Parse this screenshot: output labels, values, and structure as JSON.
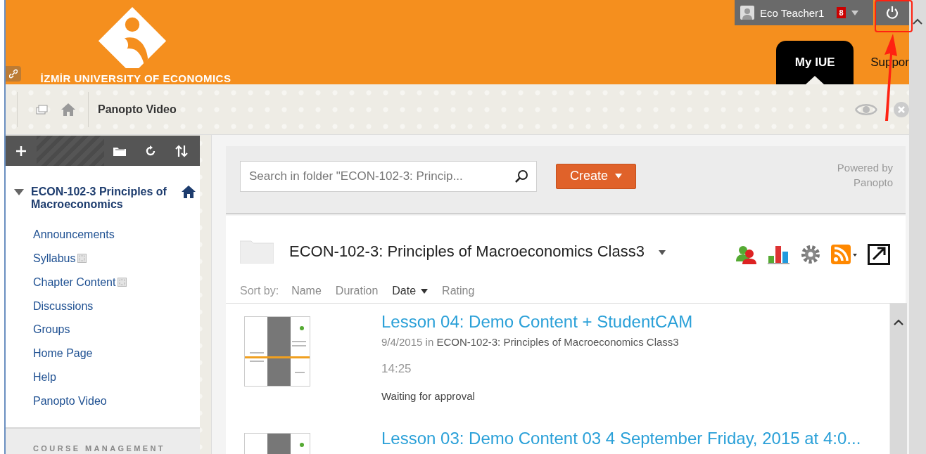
{
  "header": {
    "logo_text": "İZMİR UNIVERSITY OF ECONOMICS",
    "user_name": "Eco Teacher1",
    "notification_count": "8",
    "tabs": [
      {
        "label": "My IUE",
        "selected": true
      },
      {
        "label": "Suppor",
        "selected": false
      }
    ]
  },
  "breadcrumb": {
    "title": "Panopto Video"
  },
  "sidebar": {
    "course": {
      "title": "ECON-102-3 Principles of Macroeconomics",
      "expanded": true
    },
    "items": [
      {
        "label": "Announcements",
        "unavailable": false
      },
      {
        "label": "Syllabus",
        "unavailable": true
      },
      {
        "label": "Chapter Content",
        "unavailable": true
      },
      {
        "label": "Discussions",
        "unavailable": false
      },
      {
        "label": "Groups",
        "unavailable": false
      },
      {
        "label": "Home Page",
        "unavailable": false
      },
      {
        "label": "Help",
        "unavailable": false
      },
      {
        "label": "Panopto Video",
        "unavailable": false
      }
    ],
    "section_heading": "COURSE MANAGEMENT"
  },
  "panopto": {
    "search": {
      "placeholder": "Search in folder \"ECON-102-3: Princip..."
    },
    "create_button": "Create",
    "powered_by": "Powered by Panopto",
    "folder_title": "ECON-102-3: Principles of Macroeconomics Class3",
    "sort_label": "Sort by:",
    "sort_options": [
      {
        "label": "Name",
        "selected": false
      },
      {
        "label": "Duration",
        "selected": false
      },
      {
        "label": "Date",
        "selected": true
      },
      {
        "label": "Rating",
        "selected": false
      }
    ],
    "sessions": [
      {
        "title": "Lesson 04: Demo Content + StudentCAM",
        "date": "9/4/2015",
        "in": "in",
        "folder": "ECON-102-3: Principles of Macroeconomics Class3",
        "duration": "14:25",
        "status": "Waiting for approval"
      },
      {
        "title": "Lesson 03: Demo Content 03 4 September Friday, 2015 at 4:0..."
      }
    ]
  }
}
